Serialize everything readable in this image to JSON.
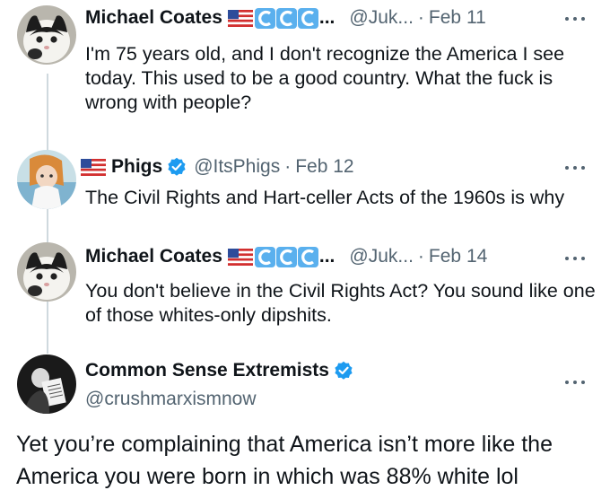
{
  "tweets": [
    {
      "name": "Michael Coates",
      "handle": "@Juk...",
      "sep": "·",
      "date": "Feb 11",
      "ellipsis": "...",
      "text": "I'm 75 years old, and I don't recognize the America I see today. This used to be a good country. What the fuck is wrong with people?"
    },
    {
      "name": "Phigs",
      "handle": "@ItsPhigs",
      "sep": "·",
      "date": "Feb 12",
      "text": "The Civil Rights and Hart-celler Acts of the 1960s is why"
    },
    {
      "name": "Michael Coates",
      "handle": "@Juk...",
      "sep": "·",
      "date": "Feb 14",
      "ellipsis": "...",
      "text": "You don't believe in the Civil Rights Act? You sound like one of those whites-only dipshits."
    }
  ],
  "main_tweet": {
    "name": "Common Sense Extremists",
    "handle": "@crushmarxismnow",
    "text": "Yet you’re complaining that America isn’t more like the America you were born in which was 88% white lol"
  },
  "icons": {
    "flag": "us-flag-icon",
    "wave": "wave-emoji-icon",
    "verified": "verified-badge-icon",
    "more": "more-options-icon"
  },
  "colors": {
    "verified": "#1d9bf0",
    "secondary_text": "#536471",
    "thread_line": "#cfd9de"
  }
}
